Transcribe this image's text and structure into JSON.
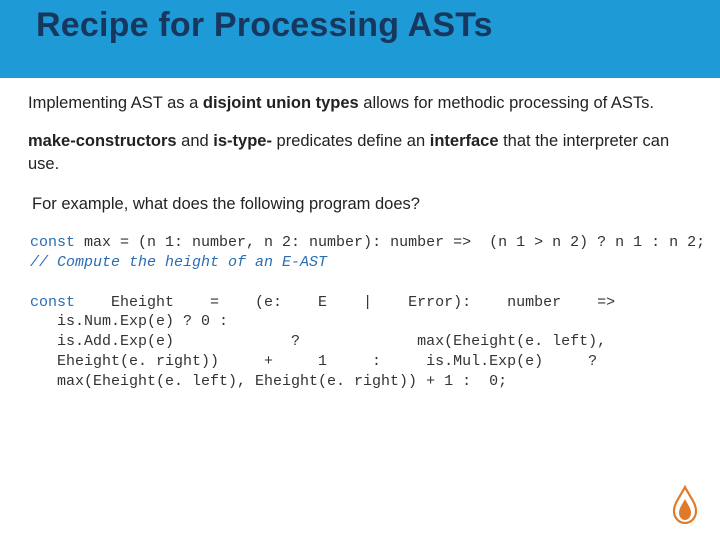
{
  "title": "Recipe for Processing ASTs",
  "p1": {
    "a": "Implementing AST as a ",
    "b": "disjoint union types",
    "c": " allows for methodic processing of ASTs."
  },
  "p2": {
    "a": "make-constructors",
    "b": " and ",
    "c": "is-type-",
    "d": "  predicates define an ",
    "e": "interface",
    "f": " that the interpreter can use."
  },
  "p3": "For example, what  does the following program does?",
  "code1": {
    "kw1": "const",
    "l1": " max = (n 1: number, n 2: number): number =>  (n 1 > n 2) ? n 1 : n 2;",
    "l2": "// Compute the height of an E-AST"
  },
  "code2": {
    "kw1": "const",
    "r1c1": "    Eheight    =    (e:    E    |    Error):    number    =>",
    "r2": "   is.Num.Exp(e) ? 0 :",
    "r3c1": "   is.Add.Exp(e)             ?             max(Eheight(e. left),",
    "r4c1": "   Eheight(e. right))     +     1     :     is.Mul.Exp(e)     ?",
    "r5": "   max(Eheight(e. left), Eheight(e. right)) + 1 :  0;"
  }
}
